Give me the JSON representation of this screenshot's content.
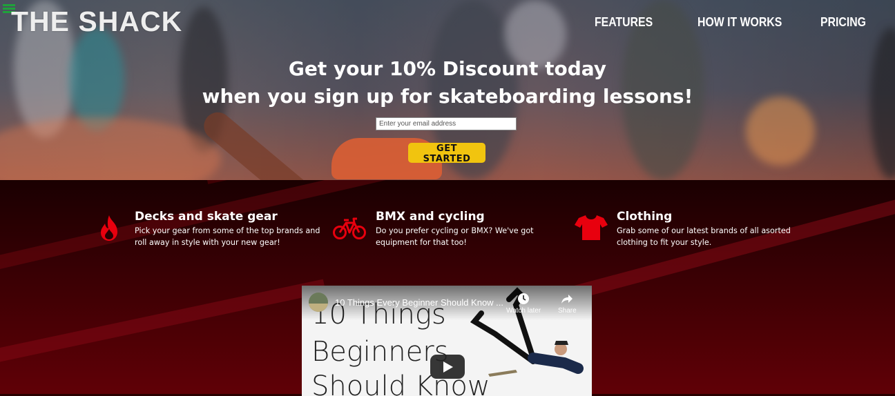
{
  "brand": {
    "logo": "THE SHACK"
  },
  "nav": {
    "items": [
      "FEATURES",
      "HOW IT WORKS",
      "PRICING"
    ]
  },
  "hero": {
    "headline_line1": "Get your 10% Discount today",
    "headline_line2": "when you sign up for skateboarding lessons!",
    "email_placeholder": "Enter your email address",
    "cta_label": "GET STARTED",
    "cta_color": "#f1c40f"
  },
  "features": [
    {
      "icon": "fire-icon",
      "title": "Decks and skate gear",
      "text": "Pick your gear from some of the top brands and roll away in style with your new gear!"
    },
    {
      "icon": "bicycle-icon",
      "title": "BMX and cycling",
      "text": "Do you prefer cycling or BMX? We've got equipment for that too!"
    },
    {
      "icon": "tshirt-icon",
      "title": "Clothing",
      "text": "Grab some of our latest brands of all asorted clothing to fit your style."
    }
  ],
  "video": {
    "title": "10 Things Every Beginner Should Know ...",
    "watch_later": "Watch later",
    "share": "Share",
    "thumbnail_line1": "10 Things",
    "thumbnail_line2": "Beginners",
    "thumbnail_line3": "Should Know"
  },
  "colors": {
    "accent_red": "#e8000e",
    "menu_green": "#1fa23b"
  }
}
